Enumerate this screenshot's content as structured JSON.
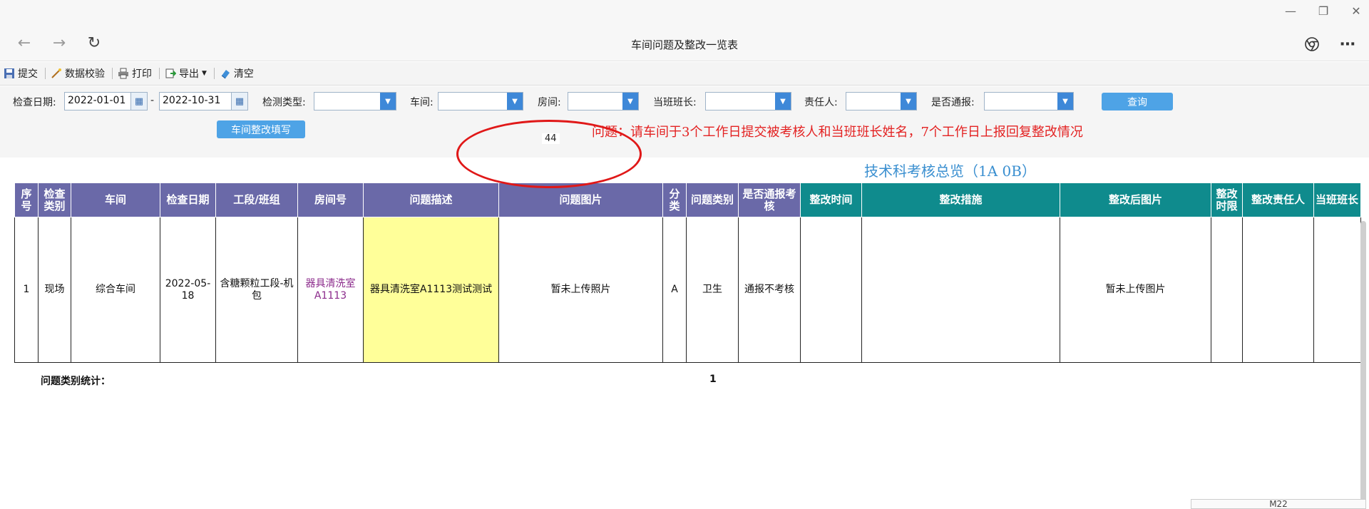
{
  "window": {
    "title": "车间问题及整改一览表"
  },
  "toolbar": {
    "submit": "提交",
    "validate": "数据校验",
    "print": "打印",
    "export": "导出",
    "clear": "清空"
  },
  "filters": {
    "check_date_label": "检查日期:",
    "date_from": "2022-01-01",
    "date_sep": "-",
    "date_to": "2022-10-31",
    "detect_type_label": "检测类型:",
    "workshop_label": "车间:",
    "room_label": "房间:",
    "shift_leader_label": "当班班长:",
    "responsible_label": "责任人:",
    "notified_label": "是否通报:",
    "query_button": "查询",
    "fill_button": "车间整改填写"
  },
  "notice": "问题：请车间于3个工作日提交被考核人和当班班长姓名，7个工作日上报回复整改情况",
  "notice_num": "44",
  "overview": "技术科考核总览（1A 0B）",
  "table": {
    "headers": [
      {
        "label": "序号",
        "key": "seq"
      },
      {
        "label": "检查类别",
        "key": "category"
      },
      {
        "label": "车间",
        "key": "workshop"
      },
      {
        "label": "检查日期",
        "key": "date"
      },
      {
        "label": "工段/班组",
        "key": "section"
      },
      {
        "label": "房间号",
        "key": "room"
      },
      {
        "label": "问题描述",
        "key": "description"
      },
      {
        "label": "问题图片",
        "key": "photo"
      },
      {
        "label": "分类",
        "key": "class"
      },
      {
        "label": "问题类别",
        "key": "type"
      },
      {
        "label": "是否通报考核",
        "key": "notified"
      },
      {
        "label": "整改时间",
        "key": "fix_time"
      },
      {
        "label": "整改措施",
        "key": "measures"
      },
      {
        "label": "整改后图片",
        "key": "after_photo"
      },
      {
        "label": "整改时限",
        "key": "deadline"
      },
      {
        "label": "整改责任人",
        "key": "fix_person"
      },
      {
        "label": "当班班长",
        "key": "leader"
      }
    ],
    "rows": [
      {
        "seq": "1",
        "category": "现场",
        "workshop": "综合车间",
        "date": "2022-05-18",
        "section": "含糖颗粒工段-机包",
        "room": "器具清洗室A1113",
        "description": "器具清洗室A1113测试测试",
        "photo": "暂未上传照片",
        "class": "A",
        "type": "卫生",
        "notified": "通报不考核",
        "fix_time": "",
        "measures": "",
        "after_photo": "暂未上传图片",
        "deadline": "",
        "fix_person": "",
        "leader": ""
      }
    ]
  },
  "stats": {
    "label": "问题类别统计：",
    "value": "1"
  },
  "bottom_tab": "M22",
  "colors": {
    "header_purple": "#6a69a8",
    "header_teal": "#0f8b8d",
    "highlight_yellow": "#ffff99",
    "notice_red": "#e32222",
    "link_blue": "#3a8fd0"
  }
}
